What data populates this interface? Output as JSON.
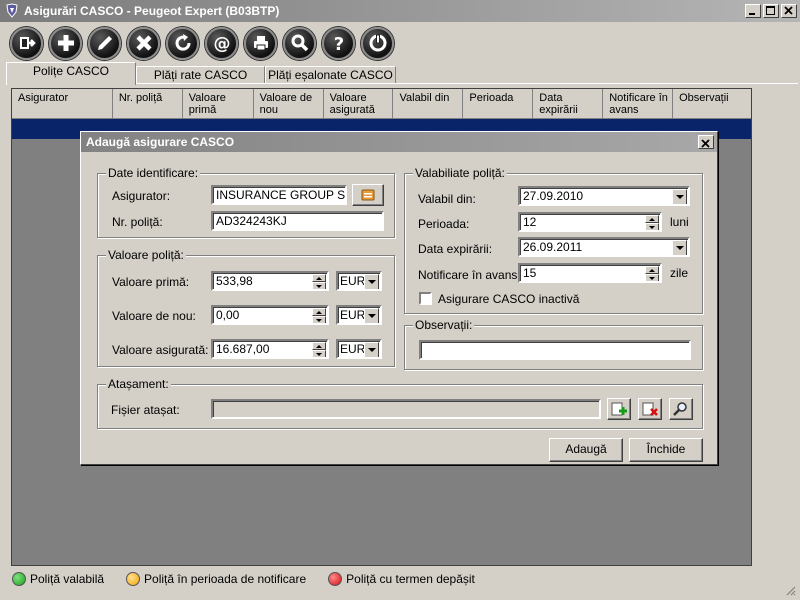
{
  "window": {
    "title": "Asigurări CASCO - Peugeot Expert (B03BTP)"
  },
  "toolbar": {
    "buttons": [
      {
        "icon": "exit-icon"
      },
      {
        "icon": "add-icon"
      },
      {
        "icon": "edit-icon"
      },
      {
        "icon": "delete-icon"
      },
      {
        "icon": "refresh-icon"
      },
      {
        "icon": "email-icon"
      },
      {
        "icon": "print-icon"
      },
      {
        "icon": "search-icon"
      },
      {
        "icon": "help-icon"
      },
      {
        "icon": "power-icon"
      }
    ]
  },
  "tabs": [
    "Polițe CASCO",
    "Plăți rate CASCO",
    "Plăți eșalonate CASCO"
  ],
  "grid": {
    "columns": [
      "Asigurator",
      "Nr. poliță",
      "Valoare primă",
      "Valoare de nou",
      "Valoare asigurată",
      "Valabil din",
      "Perioada",
      "Data expirării",
      "Notificare în avans",
      "Observații"
    ]
  },
  "dialog": {
    "title": "Adaugă asigurare CASCO",
    "identificare": {
      "legend": "Date identificare:",
      "asigurator_label": "Asigurator:",
      "asigurator_value": "INSURANCE GROUP S.A.",
      "nr_label": "Nr. poliță:",
      "nr_value": "AD324243KJ"
    },
    "valoare": {
      "legend": "Valoare poliță:",
      "prima_label": "Valoare primă:",
      "prima_value": "533,98",
      "prima_currency": "EUR",
      "nou_label": "Valoare de nou:",
      "nou_value": "0,00",
      "nou_currency": "EUR",
      "asigurata_label": "Valoare asigurată:",
      "asigurata_value": "16.687,00",
      "asigurata_currency": "EUR"
    },
    "valabilitate": {
      "legend": "Valabiliate poliță:",
      "valabil_label": "Valabil din:",
      "valabil_value": "27.09.2010",
      "perioada_label": "Perioada:",
      "perioada_value": "12",
      "perioada_unit": "luni",
      "expirare_label": "Data expirării:",
      "expirare_value": "26.09.2011",
      "notificare_label": "Notificare în avans:",
      "notificare_value": "15",
      "notificare_unit": "zile",
      "inactiv_label": "Asigurare CASCO inactivă"
    },
    "observatii": {
      "legend": "Observații:",
      "value": ""
    },
    "atasament": {
      "legend": "Atașament:",
      "fisier_label": "Fișier atașat:",
      "fisier_value": ""
    },
    "buttons": {
      "add": "Adaugă",
      "close": "Închide"
    }
  },
  "statusbar": {
    "legend": [
      {
        "label": "Poliță valabilă",
        "color": "#1aa21a"
      },
      {
        "label": "Poliță în perioada de notificare",
        "color": "#f3a20f"
      },
      {
        "label": "Poliță cu termen depășit",
        "color": "#d41010"
      }
    ]
  }
}
